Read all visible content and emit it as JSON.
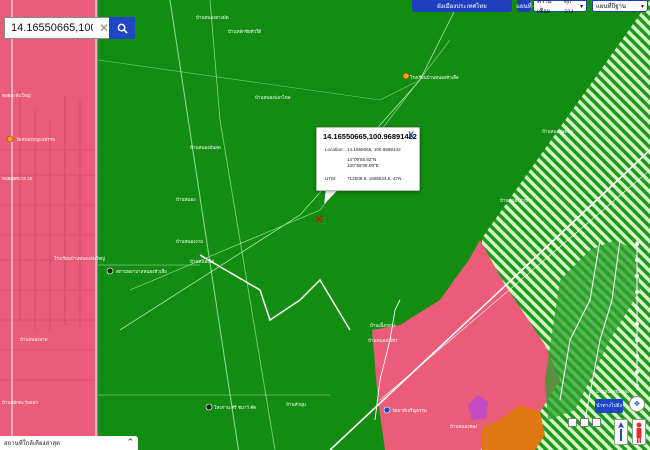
{
  "search": {
    "value": "14.16550665,100.96891422"
  },
  "topbar": {
    "province_label": "ผังเมืองประเทศไทย",
    "layer_label": "แผนที่",
    "select_label": "ความเชื่อม",
    "select_value": "ทุกวาง",
    "basemap_label": "แผนที่ปีฐาน"
  },
  "popup": {
    "title": "14.16550665,100.96891422",
    "close_label": "X",
    "location_label": "Location:",
    "location_value": "14.1655066, 100.9689142",
    "dms_lat": "14°09'55.82\"N",
    "dms_lon": "100°58'08.09\"E",
    "utm_label": "UTM:",
    "utm_value": "712508.6, 1566524.5, 47N"
  },
  "nearby_bar": {
    "label": "สถานที่ใกล้เคียงล่าสุด",
    "toggle_icon": "chevron-double-up-icon"
  },
  "controls": {
    "nav_label": "นำทางไปยัง"
  },
  "map": {
    "labels": [
      "บ้านหนองยางมัด",
      "บ้านหลักชัยหัวใต้",
      "โรงเรียนบ้านหนองหัวเสือ",
      "บ้านหนองปลาไหล",
      "ซอยสะพันใหญ่",
      "บ้านหนองอันสุด",
      "บ้านหนอง",
      "บ้านหนองงาม",
      "บ้านหนองไผ่",
      "บ้านหนองพูดอิน",
      "บ้านหนองหัวช้าง",
      "ซอยเทศบาล 15",
      "วัดหนองกุญแจสรรพ",
      "สถานพยาบาลหนองหัวเสือ",
      "โรงเรียนบ้านหนองอันใหญ่",
      "บ้านหัวมุม",
      "บ้านเนิ้งกลาง",
      "บ้านหนองเพ็ชร",
      "โหงกาน คีรี ชนาวี ค๊ด",
      "วัดมาดีเจริญธรรม",
      "บ้านหนองทอง",
      "บ้านหลักตะวันออก",
      "บ้านหนองลาด",
      "บ้านหนองขุมทอง"
    ]
  },
  "colors": {
    "zone_green": "#128d12",
    "zone_pink": "#ea5c78",
    "zone_orange": "#e07a10",
    "zone_hatch": "#c4efb0",
    "accent_blue": "#1f45c8"
  }
}
